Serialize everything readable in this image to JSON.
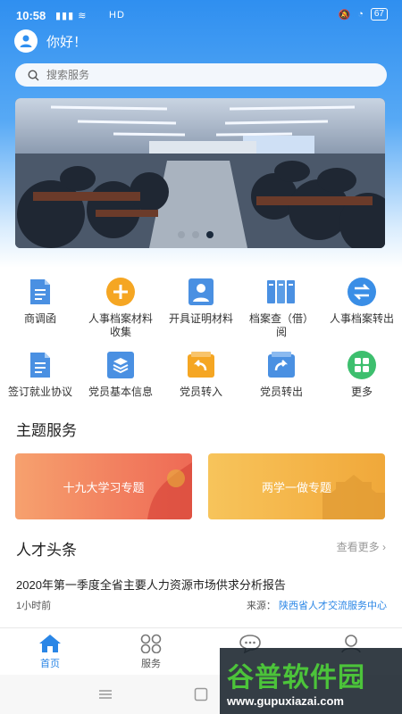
{
  "status_bar": {
    "time": "10:58",
    "network": "HD",
    "battery": "67"
  },
  "header": {
    "greeting": "你好！"
  },
  "search": {
    "placeholder": "搜索服务"
  },
  "banner": {
    "slide_count": 3,
    "active_index": 2
  },
  "services": [
    {
      "label": "商调函",
      "icon": "document-icon",
      "color": "#4a90e2"
    },
    {
      "label": "人事档案材料收集",
      "icon": "plus-icon",
      "color": "#f5a623"
    },
    {
      "label": "开具证明材料",
      "icon": "person-card-icon",
      "color": "#4a90e2"
    },
    {
      "label": "档案查（借）阅",
      "icon": "files-icon",
      "color": "#4a90e2"
    },
    {
      "label": "人事档案转出",
      "icon": "transfer-icon",
      "color": "#3a8ee6"
    },
    {
      "label": "签订就业协议",
      "icon": "document-icon",
      "color": "#4a90e2"
    },
    {
      "label": "党员基本信息",
      "icon": "layers-icon",
      "color": "#4a90e2"
    },
    {
      "label": "党员转入",
      "icon": "transfer-in-icon",
      "color": "#f5a623"
    },
    {
      "label": "党员转出",
      "icon": "transfer-out-icon",
      "color": "#4a90e2"
    },
    {
      "label": "更多",
      "icon": "grid-icon",
      "color": "#3dbf6e"
    }
  ],
  "themes": {
    "title": "主题服务",
    "cards": [
      {
        "label": "十九大学习专题"
      },
      {
        "label": "两学一做专题"
      }
    ]
  },
  "news": {
    "title": "人才头条",
    "more_label": "查看更多",
    "item_title": "2020年第一季度全省主要人力资源市场供求分析报告",
    "time": "1小时前",
    "source_label": "来源：",
    "source": "陕西省人才交流服务中心"
  },
  "tabs": [
    {
      "label": "首页",
      "icon": "home-icon",
      "active": true
    },
    {
      "label": "服务",
      "icon": "services-icon",
      "active": false
    },
    {
      "label": "",
      "icon": "chat-icon",
      "active": false
    },
    {
      "label": "",
      "icon": "user-icon",
      "active": false
    }
  ],
  "watermark": {
    "brand": "谷普软件园",
    "url": "www.gupuxiazai.com"
  },
  "colors": {
    "primary": "#2a86e6",
    "header_blue": "#2f8ff0"
  }
}
